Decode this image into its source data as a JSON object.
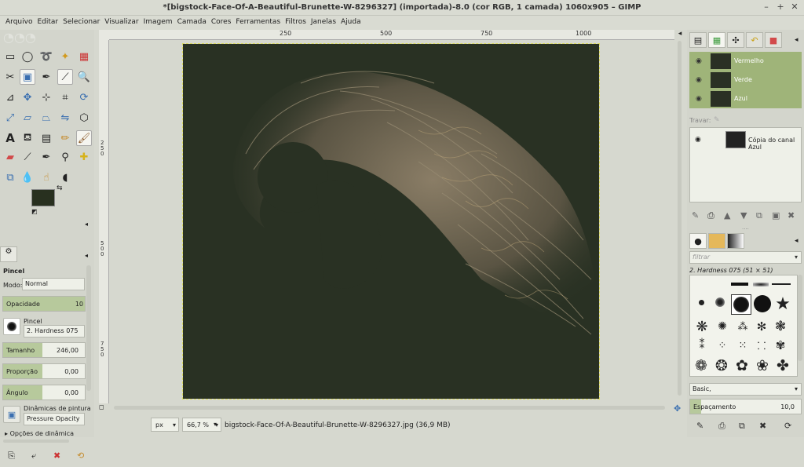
{
  "window": {
    "title": "*[bigstock-Face-Of-A-Beautiful-Brunette-W-8296327] (importada)-8.0 (cor RGB, 1 camada) 1060x905 – GIMP",
    "minimize": "–",
    "maximize": "+",
    "close": "✕"
  },
  "menu": [
    "Arquivo",
    "Editar",
    "Selecionar",
    "Visualizar",
    "Imagem",
    "Camada",
    "Cores",
    "Ferramentas",
    "Filtros",
    "Janelas",
    "Ajuda"
  ],
  "tools": [
    "rect-select",
    "ellipse-select",
    "free-select",
    "fuzzy-select",
    "select-by-color",
    "scissors",
    "foreground-select",
    "paths",
    "color-picker",
    "zoom",
    "measure",
    "move",
    "align",
    "crop",
    "rotate",
    "scale",
    "shear",
    "perspective",
    "flip",
    "cage",
    "text",
    "bucket-fill",
    "blend",
    "pencil",
    "paintbrush",
    "eraser",
    "airbrush",
    "ink",
    "clone",
    "heal",
    "perspective-clone",
    "blur",
    "smudge",
    "dodge-burn",
    "mypaint"
  ],
  "tool_options": {
    "tab_icon": "⚙",
    "title": "Pincel",
    "mode_label": "Modo:",
    "mode_value": "Normal",
    "opacity_label": "Opacidade",
    "opacity_value": "10",
    "opacity_fraction": 0.1,
    "brush_label": "Pincel",
    "brush_value": "2. Hardness 075",
    "size_label": "Tamanho",
    "size_value": "246,00",
    "aspect_label": "Proporção",
    "aspect_value": "0,00",
    "angle_label": "Ângulo",
    "angle_value": "0,00",
    "dynamics_label": "Dinâmicas de pintura",
    "dynamics_value": "Pressure Opacity",
    "dynamics_options_label": "Opções de dinâmica"
  },
  "ruler": {
    "h_labels": [
      "250",
      "500",
      "750",
      "1000"
    ],
    "v_labels": [
      "2\n5\n0",
      "5\n0\n0",
      "7\n5\n0"
    ]
  },
  "status": {
    "unit": "px",
    "zoom": "66,7 %",
    "file_info": "bigstock-Face-Of-A-Beautiful-Brunette-W-8296327.jpg (36,9 MB)"
  },
  "channels": [
    {
      "name": "Vermelho"
    },
    {
      "name": "Verde"
    },
    {
      "name": "Azul"
    }
  ],
  "lock_label": "Travar:",
  "saved_channel": {
    "name": "Cópia do canal Azul"
  },
  "brushes": {
    "filter_placeholder": "filtrar",
    "current": "2. Hardness 075 (51 × 51)",
    "preset": "Basic,",
    "spacing_label": "Espaçamento",
    "spacing_value": "10,0"
  },
  "colors": {
    "fg": "#28301f",
    "bg": "#f2f2ea",
    "canvas": "#293123",
    "selected_channel": "#9fb479",
    "slider_fill": "#b7c99c"
  }
}
